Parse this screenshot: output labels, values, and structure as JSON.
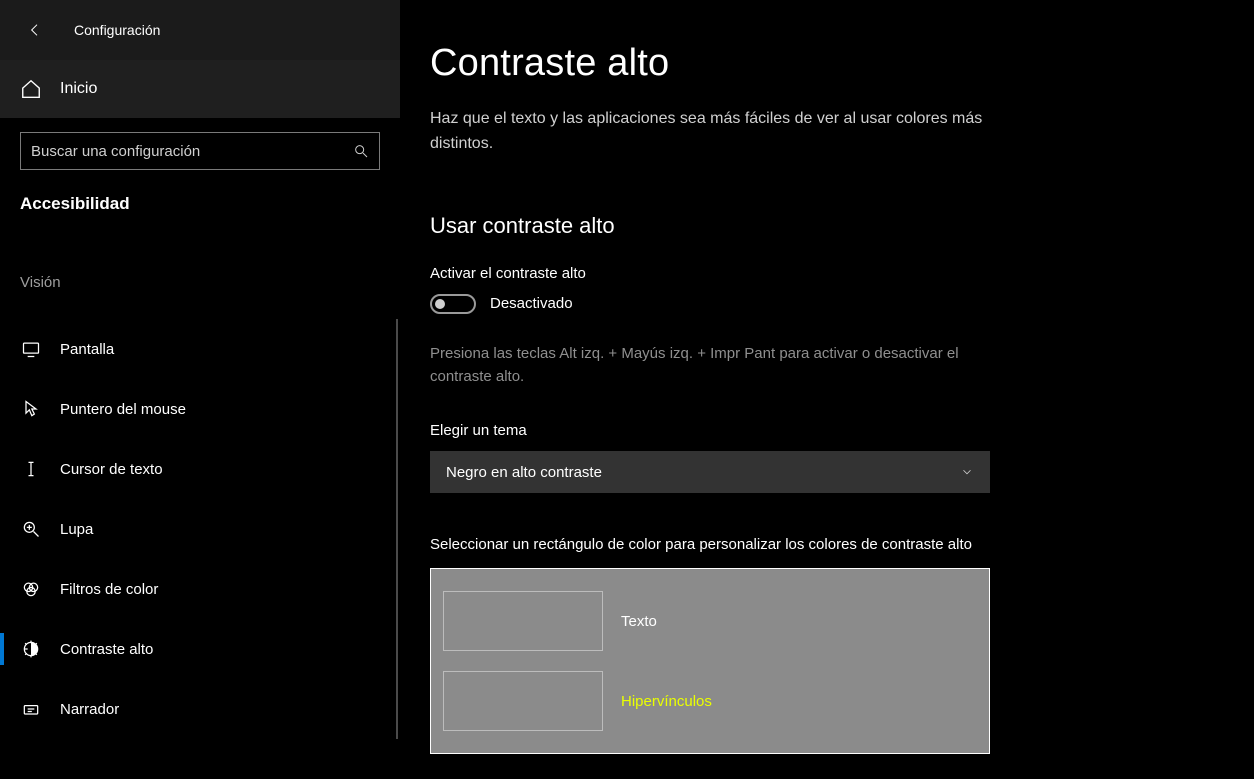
{
  "titlebar": {
    "title": "Configuración"
  },
  "home": {
    "label": "Inicio"
  },
  "search": {
    "placeholder": "Buscar una configuración"
  },
  "section": {
    "label": "Accesibilidad"
  },
  "group": {
    "label": "Visión"
  },
  "nav": {
    "items": [
      {
        "label": "Pantalla",
        "icon": "monitor-icon"
      },
      {
        "label": "Puntero del mouse",
        "icon": "pointer-icon"
      },
      {
        "label": "Cursor de texto",
        "icon": "text-cursor-icon"
      },
      {
        "label": "Lupa",
        "icon": "magnifier-icon"
      },
      {
        "label": "Filtros de color",
        "icon": "color-filters-icon"
      },
      {
        "label": "Contraste alto",
        "icon": "high-contrast-icon"
      },
      {
        "label": "Narrador",
        "icon": "narrator-icon"
      }
    ],
    "active_index": 5
  },
  "main": {
    "title": "Contraste alto",
    "description": "Haz que el texto y las aplicaciones sea más fáciles de ver al usar colores más distintos.",
    "use_section_title": "Usar contraste alto",
    "toggle_label": "Activar el contraste alto",
    "toggle_state": "Desactivado",
    "shortcut_hint": "Presiona las teclas Alt izq. + Mayús izq. + Impr Pant para activar o desactivar el contraste alto.",
    "theme_label": "Elegir un tema",
    "theme_value": "Negro en alto contraste",
    "custom_label": "Seleccionar un rectángulo de color para personalizar los colores de contraste alto",
    "color_rows": [
      {
        "label": "Texto",
        "kind": "text"
      },
      {
        "label": "Hipervínculos",
        "kind": "hyper"
      }
    ]
  }
}
